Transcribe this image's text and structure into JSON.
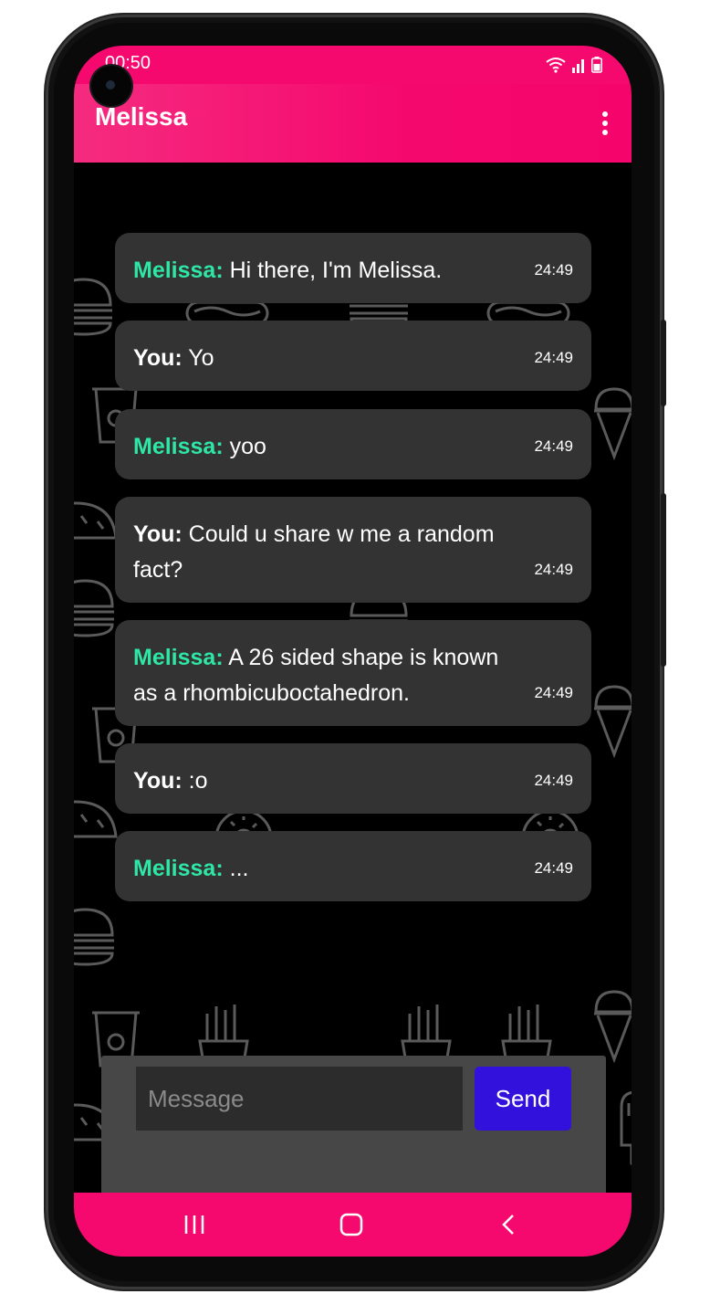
{
  "status_bar": {
    "time": "00:50"
  },
  "app_bar": {
    "title": "Melissa"
  },
  "messages": [
    {
      "sender": "Melissa:",
      "text": "Hi there, I'm Melissa.",
      "time": "24:49"
    },
    {
      "sender": "You:",
      "text": "Yo",
      "time": "24:49"
    },
    {
      "sender": "Melissa:",
      "text": "yoo",
      "time": "24:49"
    },
    {
      "sender": "You:",
      "text": "Could u share w me a random fact?",
      "time": "24:49"
    },
    {
      "sender": "Melissa:",
      "text": "A 26 sided shape is known as a rhombicuboctahedron.",
      "time": "24:49"
    },
    {
      "sender": "You:",
      "text": ":o",
      "time": "24:49"
    },
    {
      "sender": "Melissa:",
      "text": "...",
      "time": "24:49"
    }
  ],
  "composer": {
    "placeholder": "Message",
    "value": "",
    "send_label": "Send"
  },
  "colors": {
    "accent": "#f5096f",
    "bot_name": "#2ee6a6",
    "bubble": "#333333",
    "send_button": "#3311dd"
  },
  "icons": [
    "wifi-icon",
    "signal-icon",
    "battery-icon",
    "more-vert-icon",
    "recents-icon",
    "home-icon",
    "back-icon"
  ]
}
